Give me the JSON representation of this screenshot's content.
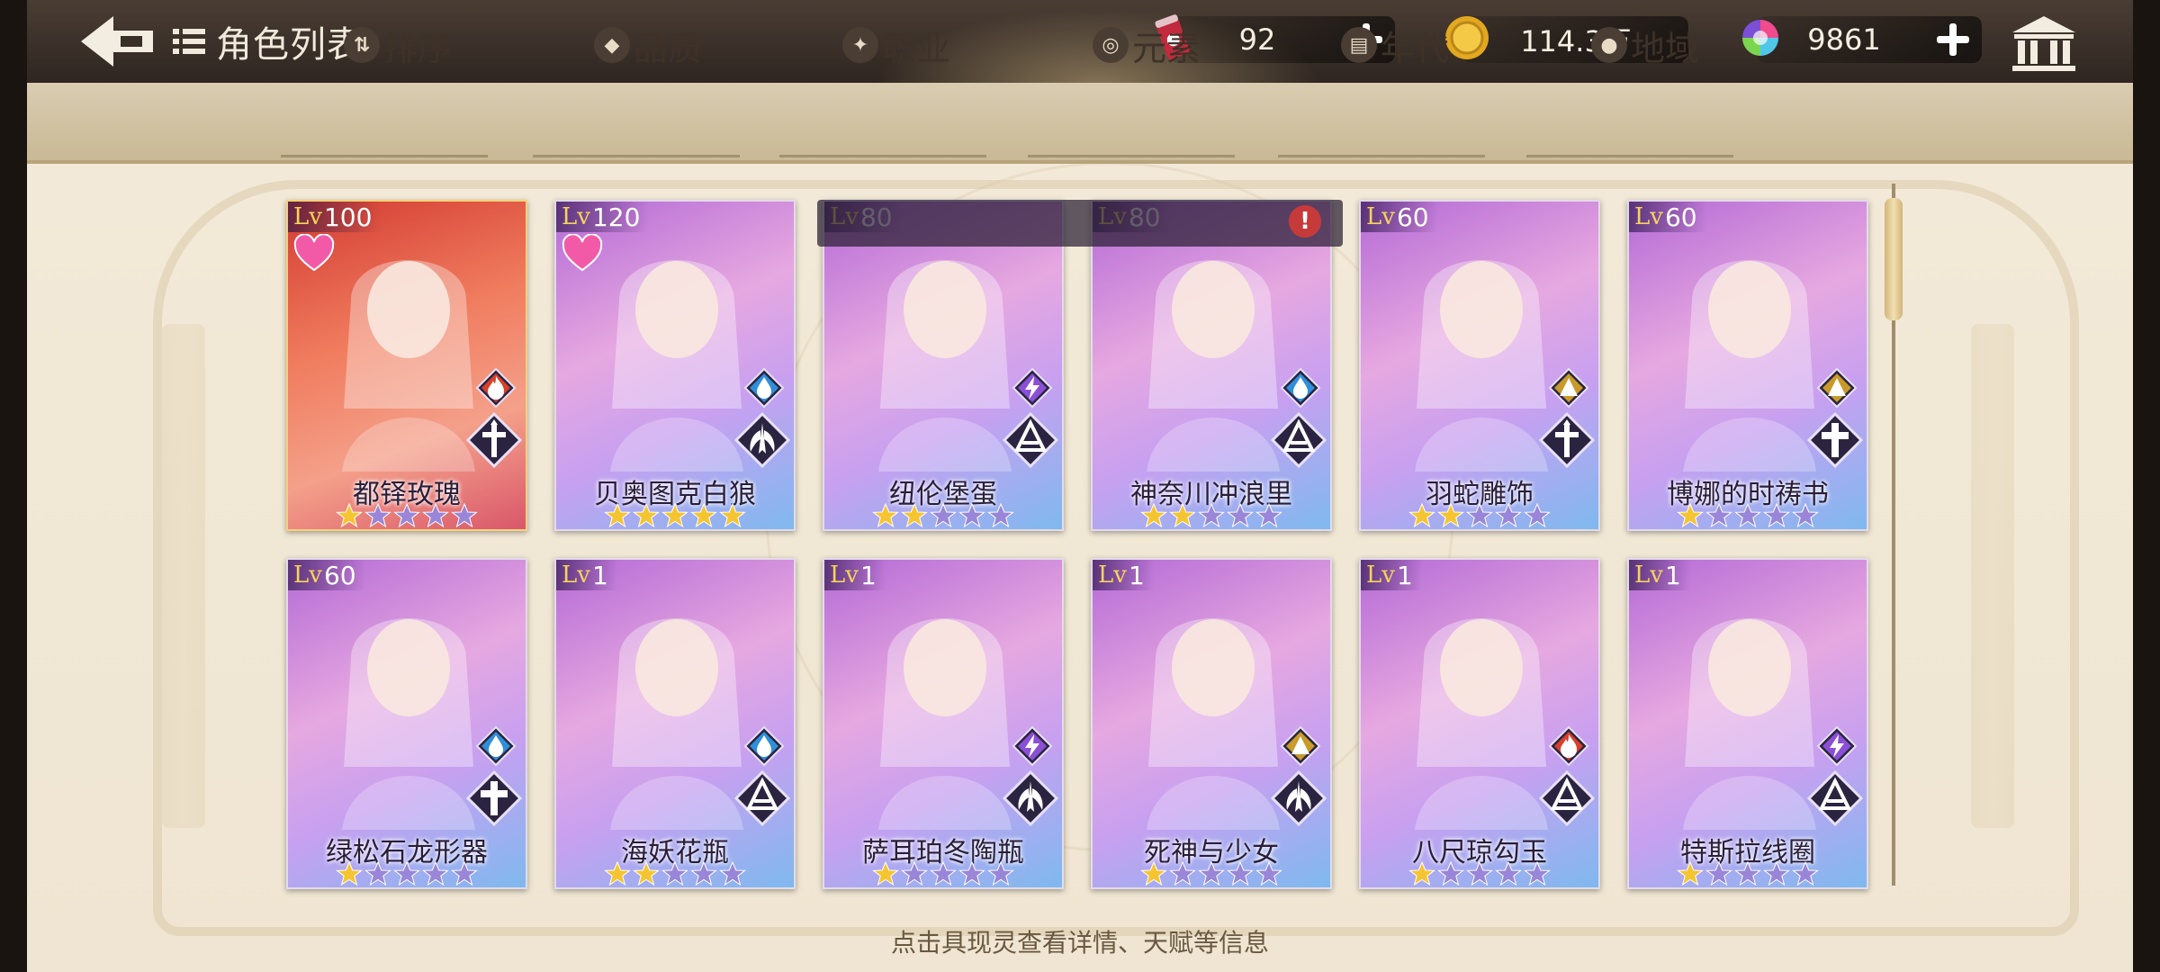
{
  "header": {
    "title": "角色列表",
    "back_icon": "back-arrow-icon",
    "list_icon": "list-icon"
  },
  "resources": [
    {
      "name": "energy",
      "icon": "energy-can-icon",
      "value": "92"
    },
    {
      "name": "gold",
      "icon": "gold-coin-icon",
      "value": "114.3万"
    },
    {
      "name": "gem",
      "icon": "rainbow-gem-icon",
      "value": "9861"
    }
  ],
  "filters": [
    {
      "label": "排序",
      "icon": "sort-icon"
    },
    {
      "label": "品质",
      "icon": "quality-icon"
    },
    {
      "label": "职业",
      "icon": "class-icon"
    },
    {
      "label": "元素",
      "icon": "element-icon"
    },
    {
      "label": "年代",
      "icon": "era-icon"
    },
    {
      "label": "地域",
      "icon": "region-icon"
    }
  ],
  "cards": [
    {
      "name": "都铎玫瑰",
      "level": "100",
      "stars": 1,
      "heart": true,
      "element": "fire",
      "cls": "cross-sword",
      "theme": "red"
    },
    {
      "name": "贝奥图克白狼",
      "level": "120",
      "stars": 5,
      "heart": true,
      "element": "water",
      "cls": "wing",
      "theme": "purple"
    },
    {
      "name": "纽伦堡蛋",
      "level": "80",
      "stars": 2,
      "heart": false,
      "element": "thunder",
      "cls": "book",
      "theme": "purple"
    },
    {
      "name": "神奈川冲浪里",
      "level": "80",
      "stars": 2,
      "heart": false,
      "element": "water",
      "cls": "book",
      "theme": "purple"
    },
    {
      "name": "羽蛇雕饰",
      "level": "60",
      "stars": 2,
      "heart": false,
      "element": "earth",
      "cls": "cross-sword",
      "theme": "purple"
    },
    {
      "name": "博娜的时祷书",
      "level": "60",
      "stars": 1,
      "heart": false,
      "element": "earth",
      "cls": "cross",
      "theme": "purple"
    },
    {
      "name": "绿松石龙形器",
      "level": "60",
      "stars": 1,
      "heart": false,
      "element": "water",
      "cls": "cross",
      "theme": "purple"
    },
    {
      "name": "海妖花瓶",
      "level": "1",
      "stars": 2,
      "heart": false,
      "element": "water",
      "cls": "book",
      "theme": "purple"
    },
    {
      "name": "萨耳珀冬陶瓶",
      "level": "1",
      "stars": 1,
      "heart": false,
      "element": "thunder",
      "cls": "wing",
      "theme": "purple"
    },
    {
      "name": "死神与少女",
      "level": "1",
      "stars": 1,
      "heart": false,
      "element": "earth",
      "cls": "wing",
      "theme": "purple"
    },
    {
      "name": "八尺琼勾玉",
      "level": "1",
      "stars": 1,
      "heart": false,
      "element": "fire",
      "cls": "book",
      "theme": "purple"
    },
    {
      "name": "特斯拉线圈",
      "level": "1",
      "stars": 1,
      "heart": false,
      "element": "thunder",
      "cls": "book",
      "theme": "purple"
    }
  ],
  "lv_prefix": "Lv",
  "banner_alert": "!",
  "hint": "点击具现灵查看详情、天赋等信息",
  "colors": {
    "fire": "#d9402c",
    "water": "#2f8fd8",
    "thunder": "#8a4fd6",
    "earth": "#c79a2a",
    "star_gold": "#f5c531",
    "star_empty": "#9a86d8"
  }
}
